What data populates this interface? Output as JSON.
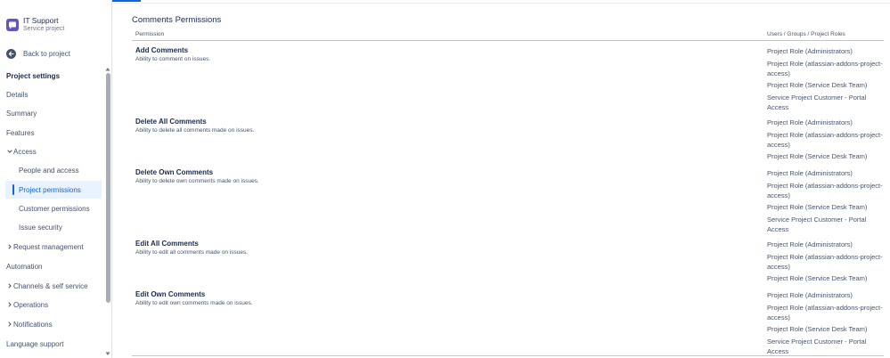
{
  "project": {
    "name": "IT Support",
    "type": "Service project"
  },
  "sidebar": {
    "back_label": "Back to project",
    "section_title": "Project settings",
    "items": [
      {
        "label": "Details",
        "level": 0
      },
      {
        "label": "Summary",
        "level": 0
      },
      {
        "label": "Features",
        "level": 0
      },
      {
        "label": "Access",
        "level": 0,
        "chevron": "down"
      },
      {
        "label": "People and access",
        "level": 1
      },
      {
        "label": "Project permissions",
        "level": 1,
        "active": true
      },
      {
        "label": "Customer permissions",
        "level": 1
      },
      {
        "label": "Issue security",
        "level": 1
      },
      {
        "label": "Request management",
        "level": 0,
        "chevron": "right"
      },
      {
        "label": "Automation",
        "level": 0
      },
      {
        "label": "Channels & self service",
        "level": 0,
        "chevron": "right"
      },
      {
        "label": "Operations",
        "level": 0,
        "chevron": "right"
      },
      {
        "label": "Notifications",
        "level": 0,
        "chevron": "right"
      },
      {
        "label": "Language support",
        "level": 0
      }
    ]
  },
  "main": {
    "title": "Comments Permissions",
    "columns": {
      "permission": "Permission",
      "roles": "Users / Groups / Project Roles"
    },
    "permissions": [
      {
        "name": "Add Comments",
        "description": "Ability to comment on issues.",
        "roles": [
          "Project Role (Administrators)",
          "Project Role (atlassian-addons-project-access)",
          "Project Role (Service Desk Team)",
          "Service Project Customer - Portal Access"
        ]
      },
      {
        "name": "Delete All Comments",
        "description": "Ability to delete all comments made on issues.",
        "roles": [
          "Project Role (Administrators)",
          "Project Role (atlassian-addons-project-access)",
          "Project Role (Service Desk Team)"
        ]
      },
      {
        "name": "Delete Own Comments",
        "description": "Ability to delete own comments made on issues.",
        "roles": [
          "Project Role (Administrators)",
          "Project Role (atlassian-addons-project-access)",
          "Project Role (Service Desk Team)",
          "Service Project Customer - Portal Access"
        ]
      },
      {
        "name": "Edit All Comments",
        "description": "Ability to edit all comments made on issues.",
        "roles": [
          "Project Role (Administrators)",
          "Project Role (atlassian-addons-project-access)",
          "Project Role (Service Desk Team)"
        ]
      },
      {
        "name": "Edit Own Comments",
        "description": "Ability to edit own comments made on issues.",
        "roles": [
          "Project Role (Administrators)",
          "Project Role (atlassian-addons-project-access)",
          "Project Role (Service Desk Team)",
          "Service Project Customer - Portal Access"
        ]
      }
    ]
  },
  "colors": {
    "accent": "#0c66e4",
    "active_bg": "#e9f2ff",
    "text": "#172b4d",
    "subtle_text": "#44546f",
    "project_avatar": "#6554c0"
  },
  "icons": {
    "project_avatar": "chat-bubble-icon",
    "back": "arrow-left-icon",
    "chevron_down": "chevron-down-icon",
    "chevron_right": "chevron-right-icon"
  }
}
